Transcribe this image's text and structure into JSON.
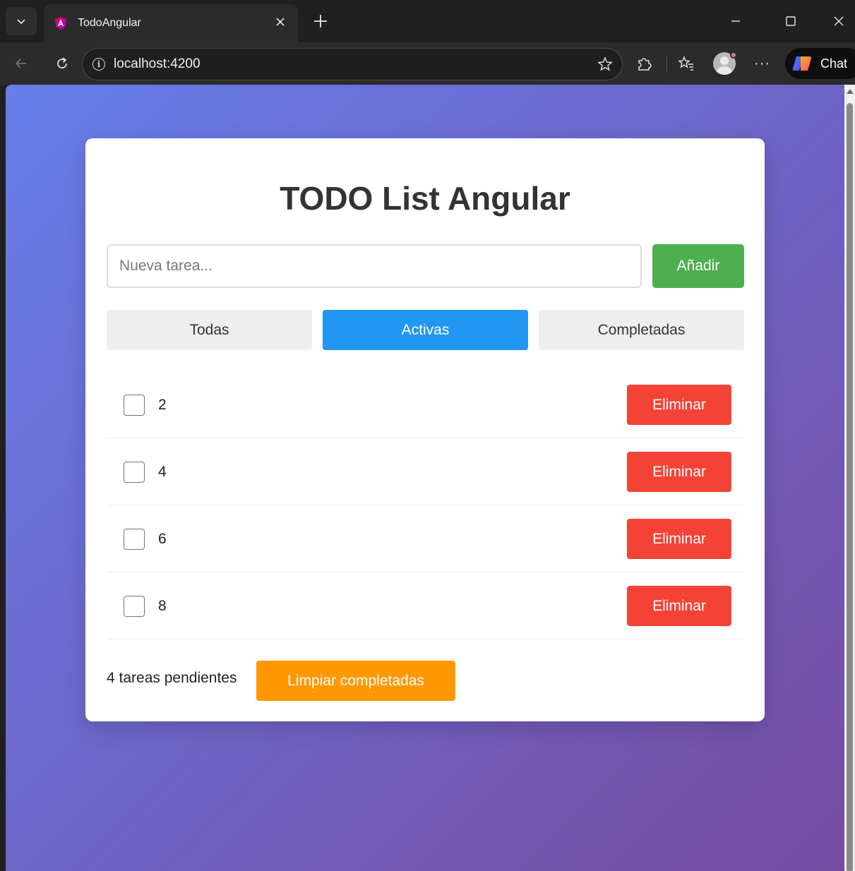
{
  "browser": {
    "tab_title": "TodoAngular",
    "url": "localhost:4200",
    "chat_label": "Chat",
    "more_label": "···"
  },
  "app": {
    "title": "TODO List Angular",
    "input": {
      "placeholder": "Nueva tarea...",
      "value": ""
    },
    "add_label": "Añadir",
    "filters": [
      {
        "label": "Todas",
        "active": false
      },
      {
        "label": "Activas",
        "active": true
      },
      {
        "label": "Completadas",
        "active": false
      }
    ],
    "todos": [
      {
        "text": "2",
        "completed": false,
        "delete_label": "Eliminar"
      },
      {
        "text": "4",
        "completed": false,
        "delete_label": "Eliminar"
      },
      {
        "text": "6",
        "completed": false,
        "delete_label": "Eliminar"
      },
      {
        "text": "8",
        "completed": false,
        "delete_label": "Eliminar"
      }
    ],
    "pending_text": "4 tareas pendientes",
    "clear_label": "Limpiar completadas"
  },
  "colors": {
    "gradient_start": "#667eea",
    "gradient_end": "#764ba2",
    "add": "#4caf50",
    "active_filter": "#2196f3",
    "delete": "#f44336",
    "clear": "#ff9800"
  }
}
